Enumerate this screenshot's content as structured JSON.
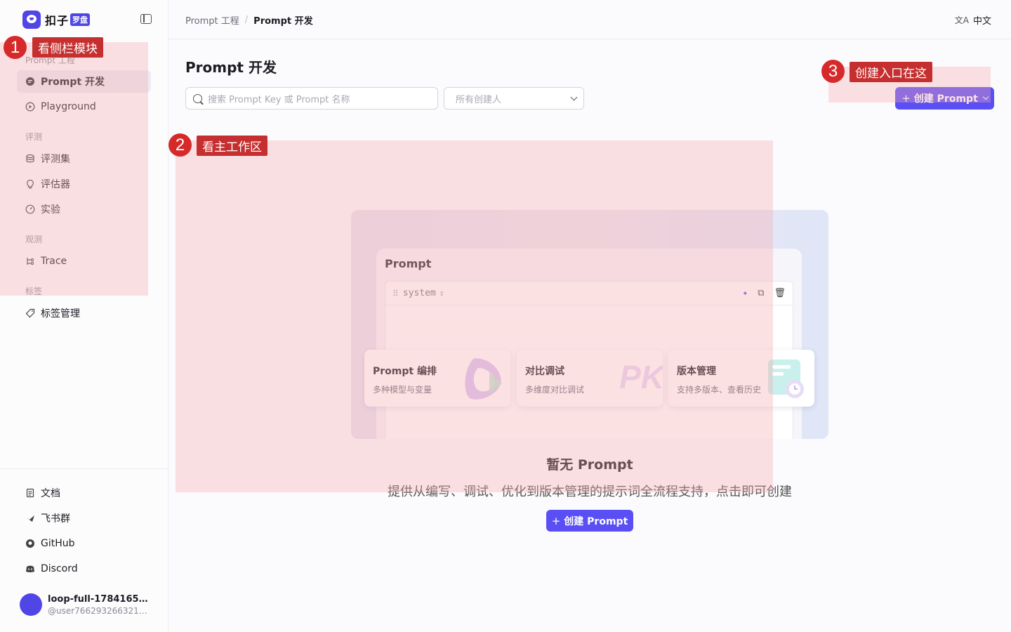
{
  "app": {
    "logo_text": "扣子",
    "logo_badge": "罗盘"
  },
  "header": {
    "breadcrumb": [
      "Prompt 工程",
      "/",
      "Prompt 开发"
    ],
    "language": "中文",
    "language_icon": "文A"
  },
  "sidebar": {
    "sections": [
      {
        "title": "Prompt 工程",
        "items": [
          {
            "label": "Prompt 开发",
            "icon": "prompt-icon",
            "active": true
          },
          {
            "label": "Playground",
            "icon": "play-circle-icon"
          }
        ]
      },
      {
        "title": "评测",
        "items": [
          {
            "label": "评测集",
            "icon": "database-icon"
          },
          {
            "label": "评估器",
            "icon": "bulb-icon"
          },
          {
            "label": "实验",
            "icon": "gauge-icon"
          }
        ]
      },
      {
        "title": "观测",
        "items": [
          {
            "label": "Trace",
            "icon": "trace-icon"
          }
        ]
      },
      {
        "title": "标签",
        "items": [
          {
            "label": "标签管理",
            "icon": "tag-icon"
          }
        ]
      }
    ],
    "footer_items": [
      {
        "label": "文档",
        "icon": "document-icon"
      },
      {
        "label": "飞书群",
        "icon": "feishu-icon"
      },
      {
        "label": "GitHub",
        "icon": "github-icon"
      },
      {
        "label": "Discord",
        "icon": "discord-icon"
      }
    ],
    "user": {
      "name": "loop-full-178416554...",
      "handle": "@user76629326632121..."
    }
  },
  "main": {
    "title": "Prompt 开发",
    "search_placeholder": "搜索 Prompt Key 或 Prompt 名称",
    "creator_select_placeholder": "所有创建人",
    "create_button": "创建 Prompt",
    "illustration": {
      "card_title": "Prompt",
      "editor_role": "system",
      "features": [
        {
          "title": "Prompt 编排",
          "desc": "多种模型与变量"
        },
        {
          "title": "对比调试",
          "desc": "多维度对比调试"
        },
        {
          "title": "版本管理",
          "desc": "支持多版本、查看历史"
        }
      ],
      "pk_text": "PK"
    },
    "empty_title": "暂无 Prompt",
    "empty_desc": "提供从编写、调试、优化到版本管理的提示词全流程支持，点击即可创建",
    "empty_create_button": "创建 Prompt"
  },
  "annotations": [
    {
      "num": "1",
      "label": "看侧栏模块"
    },
    {
      "num": "2",
      "label": "看主工作区"
    },
    {
      "num": "3",
      "label": "创建入口在这"
    }
  ],
  "colors": {
    "primary": "#5a4ff5",
    "annotation": "#d62a2a",
    "overlay": "#f6aab0"
  }
}
